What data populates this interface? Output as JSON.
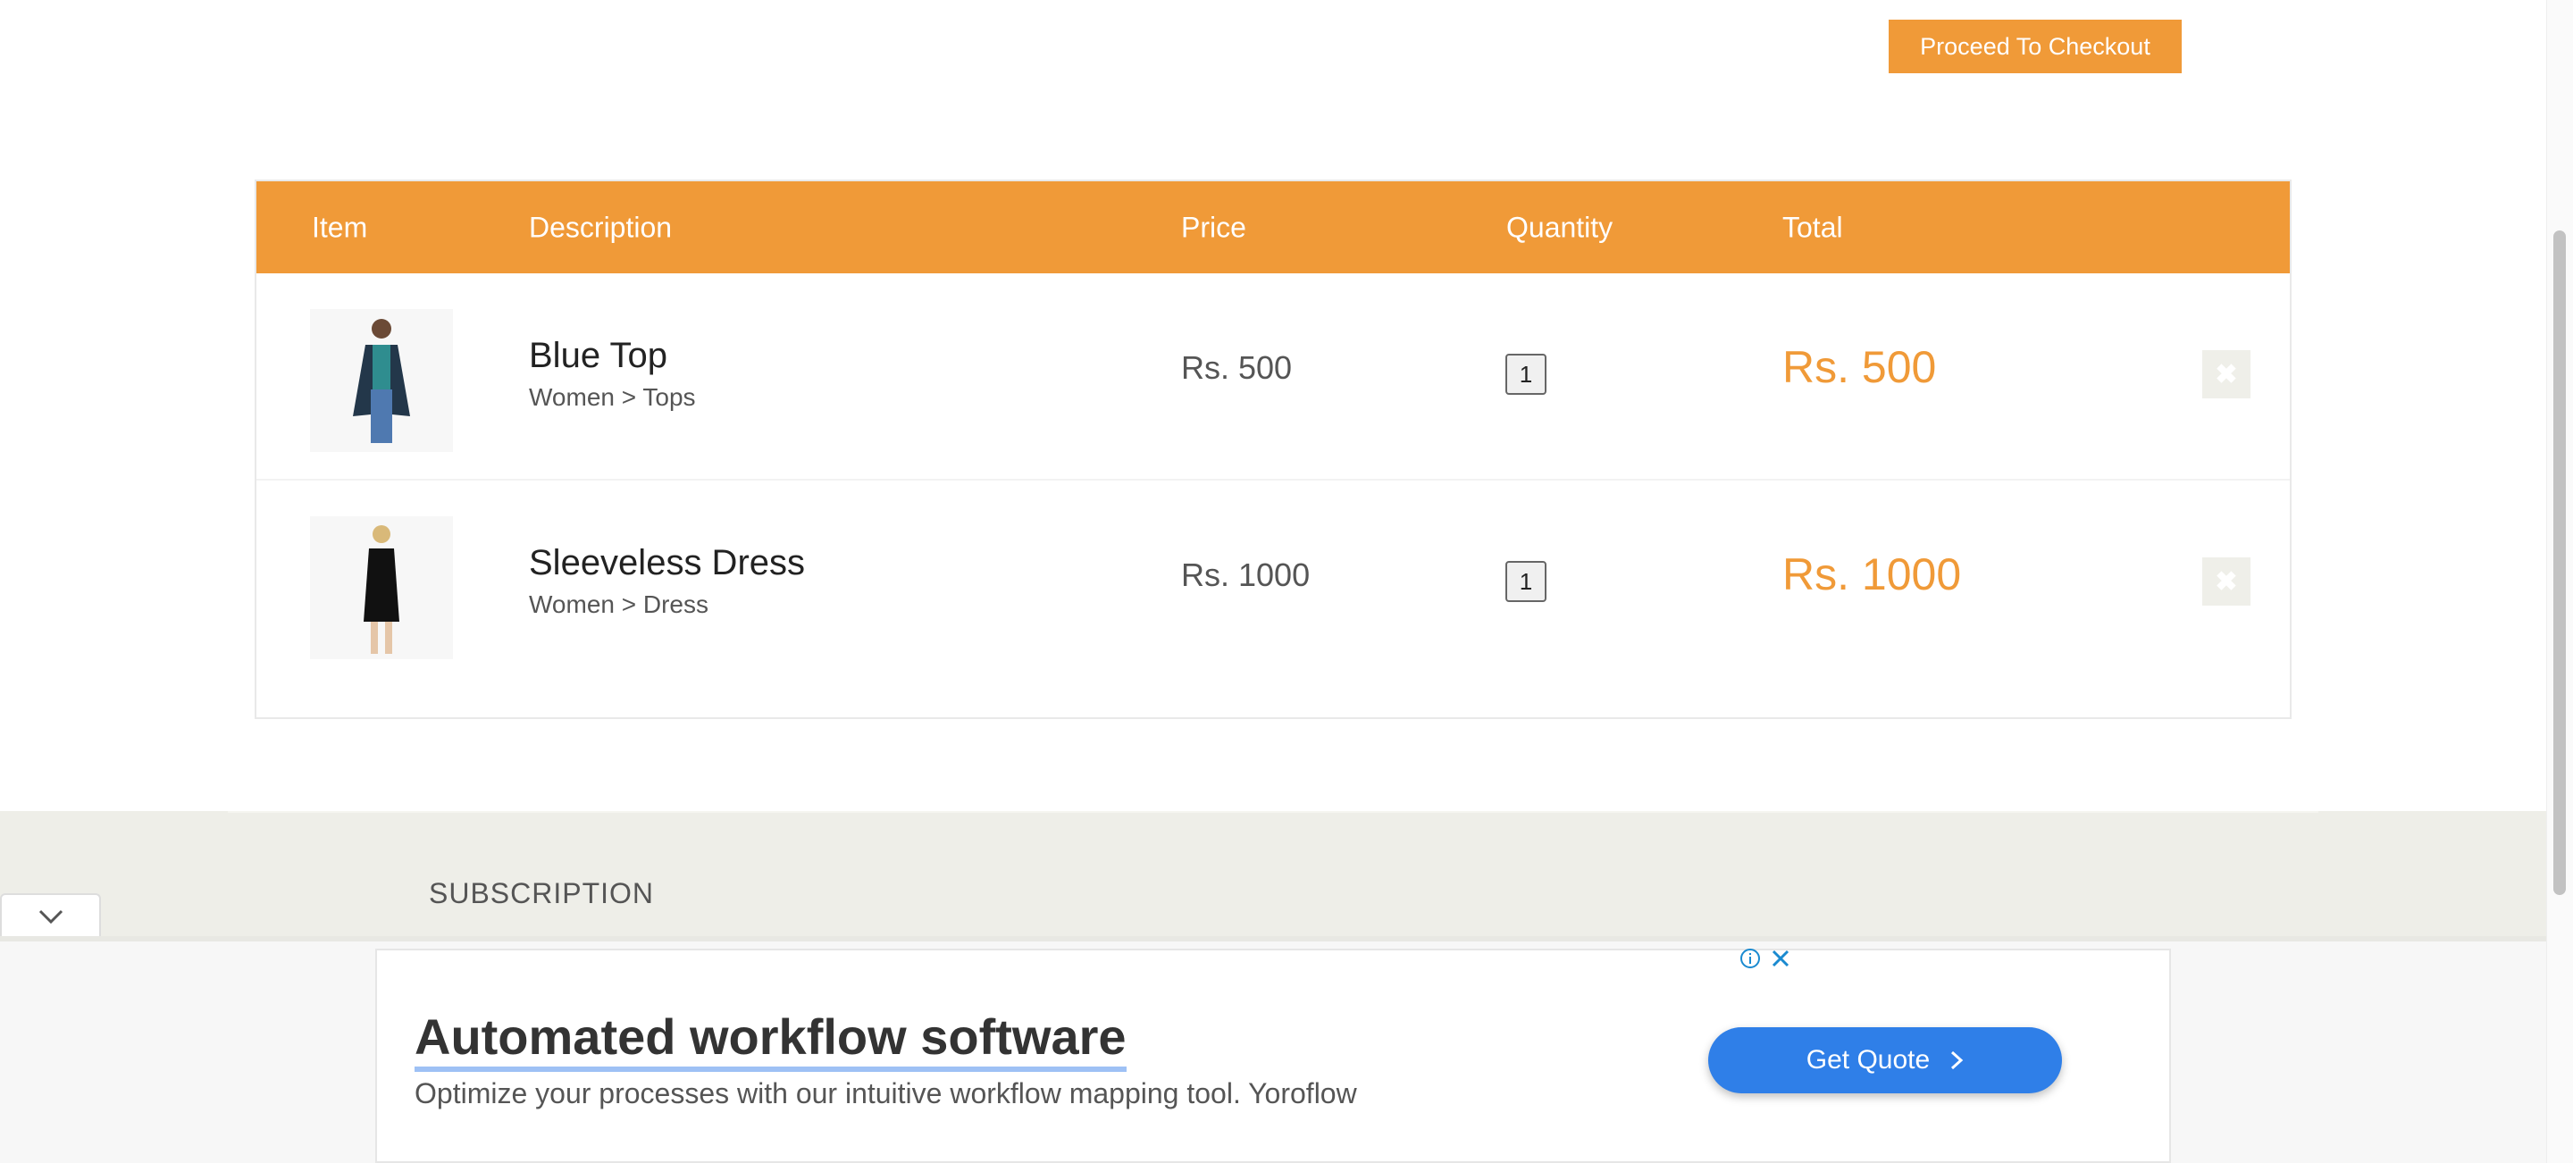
{
  "checkout": {
    "label": "Proceed To Checkout"
  },
  "cart": {
    "headers": {
      "item": "Item",
      "description": "Description",
      "price": "Price",
      "quantity": "Quantity",
      "total": "Total"
    },
    "rows": [
      {
        "name": "Blue Top",
        "category": "Women > Tops",
        "price": "Rs. 500",
        "quantity": "1",
        "total": "Rs. 500",
        "delete_icon": "close-icon"
      },
      {
        "name": "Sleeveless Dress",
        "category": "Women > Dress",
        "price": "Rs. 1000",
        "quantity": "1",
        "total": "Rs. 1000",
        "delete_icon": "close-icon"
      }
    ]
  },
  "footer": {
    "subscription": "SUBSCRIPTION"
  },
  "ad": {
    "title": "Automated workflow software",
    "text": "Optimize your processes with our intuitive workflow mapping tool. Yoroflow",
    "cta": "Get Quote"
  },
  "colors": {
    "accent": "#f09a38",
    "cta": "#2f7fe8",
    "footer_bg": "#eeeee8"
  }
}
